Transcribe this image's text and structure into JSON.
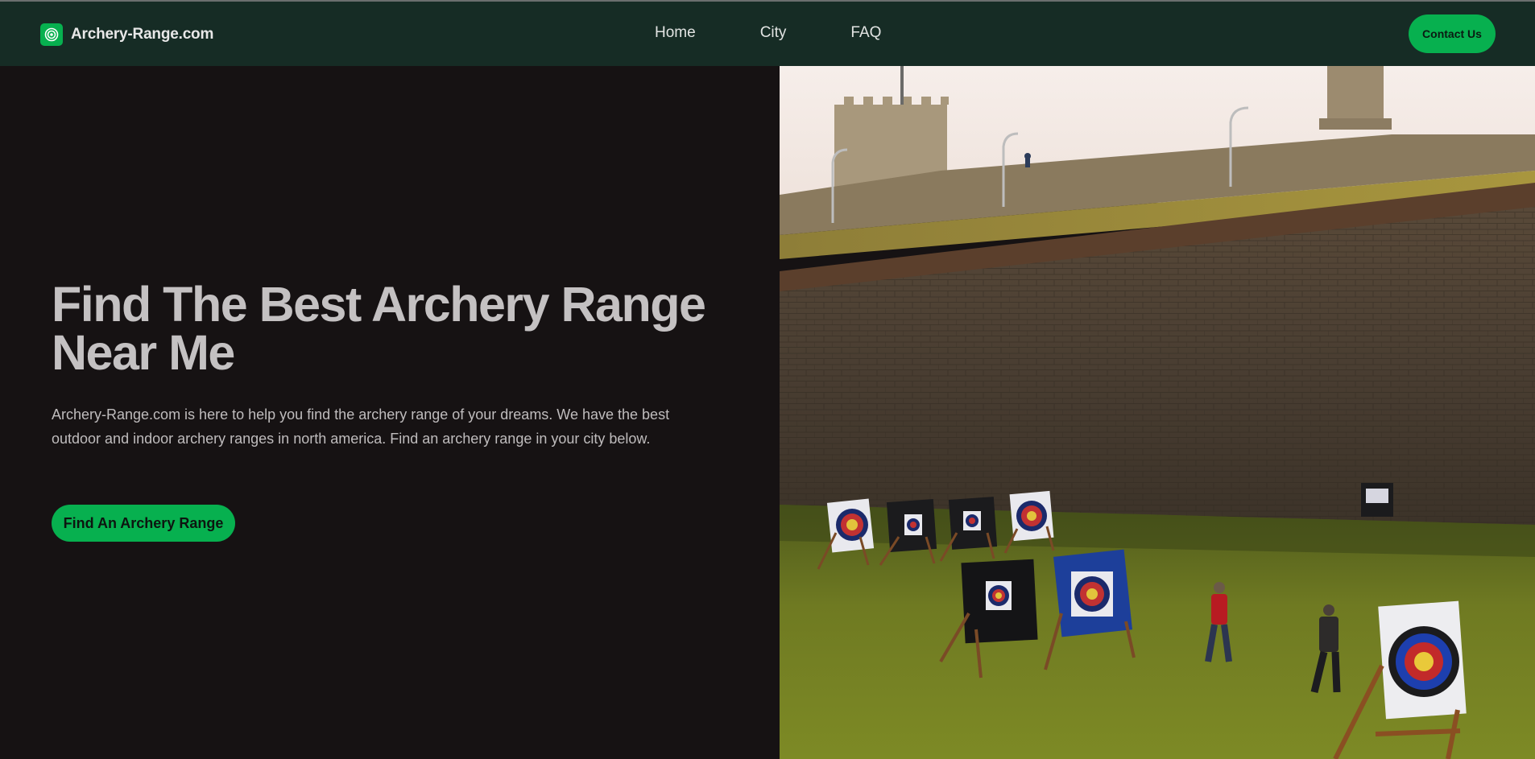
{
  "site": {
    "brand_name": "Archery-Range.com",
    "logo_icon": "target-icon",
    "accent_color": "#07b04f",
    "header_color": "#162c25"
  },
  "nav": {
    "items": [
      {
        "label": "Home"
      },
      {
        "label": "City"
      },
      {
        "label": "FAQ"
      }
    ],
    "contact_label": "Contact Us"
  },
  "hero": {
    "title": "Find The Best Archery Range Near Me",
    "intro": "Archery-Range.com is here to help you find the archery range of your dreams. We have the best outdoor and indoor archery ranges in north america. Find an archery range in your city below.",
    "cta_label": "Find An Archery Range"
  }
}
